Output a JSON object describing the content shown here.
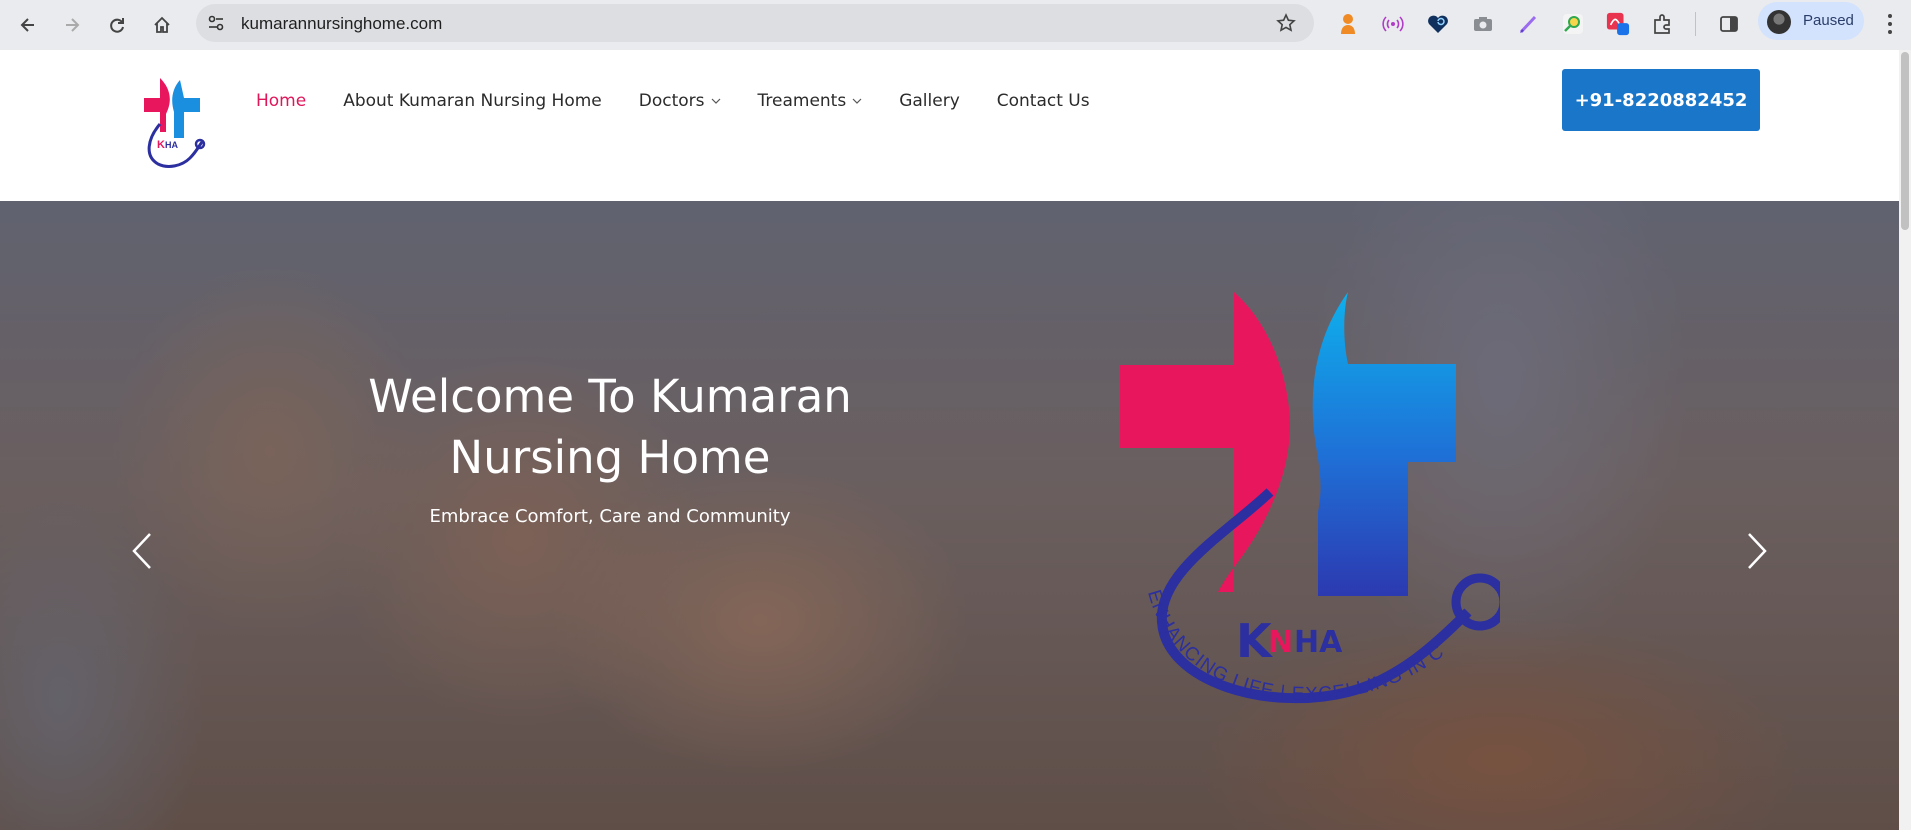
{
  "browser": {
    "url": "kumarannursinghome.com",
    "profile_status": "Paused",
    "icons": {
      "back": "back-arrow-icon",
      "forward": "forward-arrow-icon",
      "reload": "reload-icon",
      "home": "home-icon",
      "site_info": "tune-icon",
      "bookmark": "star-icon",
      "extensions": [
        "orange-extension-icon",
        "broadcast-icon",
        "heart-extension-icon",
        "camera-icon",
        "pen-icon",
        "magnifier-icon",
        "pdf-extension-icon",
        "puzzle-icon",
        "side-panel-icon"
      ],
      "menu": "kebab-menu-icon"
    }
  },
  "header": {
    "nav": [
      {
        "label": "Home",
        "active": true
      },
      {
        "label": "About Kumaran Nursing Home",
        "active": false
      },
      {
        "label": "Doctors",
        "active": false,
        "dropdown": true
      },
      {
        "label": "Treaments",
        "active": false,
        "dropdown": true
      },
      {
        "label": "Gallery",
        "active": false
      },
      {
        "label": "Contact Us",
        "active": false
      }
    ],
    "phone_button": "+91-8220882452"
  },
  "hero": {
    "title": "Welcome To Kumaran Nursing Home",
    "subtitle": "Embrace Comfort, Care and Community",
    "logo": {
      "initials": "KNHA",
      "tagline": "ENHANCING LIFE | EXCELLING IN CARE !!"
    }
  },
  "colors": {
    "brand_pink": "#e8175d",
    "brand_blue": "#1976c9",
    "brand_cyan": "#13a8e8",
    "logo_navy": "#2c2fa0",
    "nav_active": "#e0165b"
  }
}
